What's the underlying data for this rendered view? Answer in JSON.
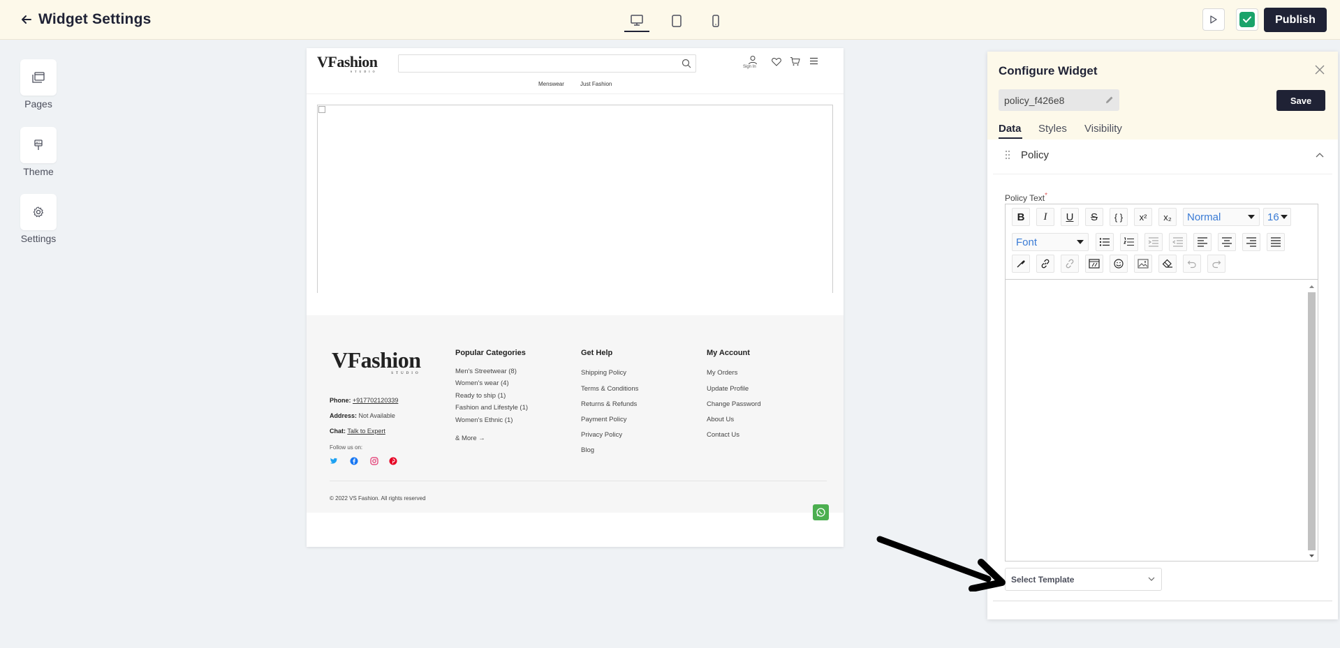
{
  "header": {
    "back_icon": "arrow-left-icon",
    "title": "Widget Settings",
    "devices": [
      {
        "name": "desktop",
        "icon": "monitor-icon",
        "active": true
      },
      {
        "name": "tablet",
        "icon": "tablet-icon",
        "active": false
      },
      {
        "name": "mobile",
        "icon": "phone-icon",
        "active": false
      }
    ],
    "publish_label": "Publish",
    "accent_color": "#1f2235",
    "check_color": "#1aa36a"
  },
  "sidebar": {
    "items": [
      {
        "label": "Pages",
        "icon": "pages-icon"
      },
      {
        "label": "Theme",
        "icon": "brush-icon"
      },
      {
        "label": "Settings",
        "icon": "gear-icon"
      }
    ]
  },
  "preview": {
    "logo": "VFashion",
    "logo_sub": "STUDIO",
    "signin": "Sign In",
    "nav": [
      "Menswear",
      "Just Fashion"
    ],
    "footer": {
      "phone_label": "Phone:",
      "phone": "+917702120339",
      "address_label": "Address:",
      "address": "Not Available",
      "chat_label": "Chat:",
      "chat": "Talk to Expert",
      "follow": "Follow us on:",
      "columns": [
        {
          "title": "Popular Categories",
          "links": [
            "Men's Streetwear (8)",
            "Women's wear (4)",
            "Ready to ship (1)",
            "Fashion and Lifestyle (1)",
            "Women's Ethnic (1)"
          ],
          "more": "& More"
        },
        {
          "title": "Get Help",
          "links": [
            "Shipping Policy",
            "Terms & Conditions",
            "Returns & Refunds",
            "Payment Policy",
            "Privacy Policy",
            "Blog"
          ]
        },
        {
          "title": "My Account",
          "links": [
            "My Orders",
            "Update Profile",
            "Change Password",
            "About Us",
            "Contact Us"
          ]
        }
      ],
      "copyright": "© 2022 VS Fashion. All rights reserved"
    }
  },
  "panel": {
    "title": "Configure Widget",
    "widget_name": "policy_f426e8",
    "save_label": "Save",
    "tabs": [
      "Data",
      "Styles",
      "Visibility"
    ],
    "active_tab": "Data",
    "section_title": "Policy",
    "field_label": "Policy Text",
    "required_mark": "*",
    "toolbar": {
      "heading_select": "Normal",
      "size_select": "16",
      "font_select": "Font"
    },
    "select_template": "Select Template"
  }
}
